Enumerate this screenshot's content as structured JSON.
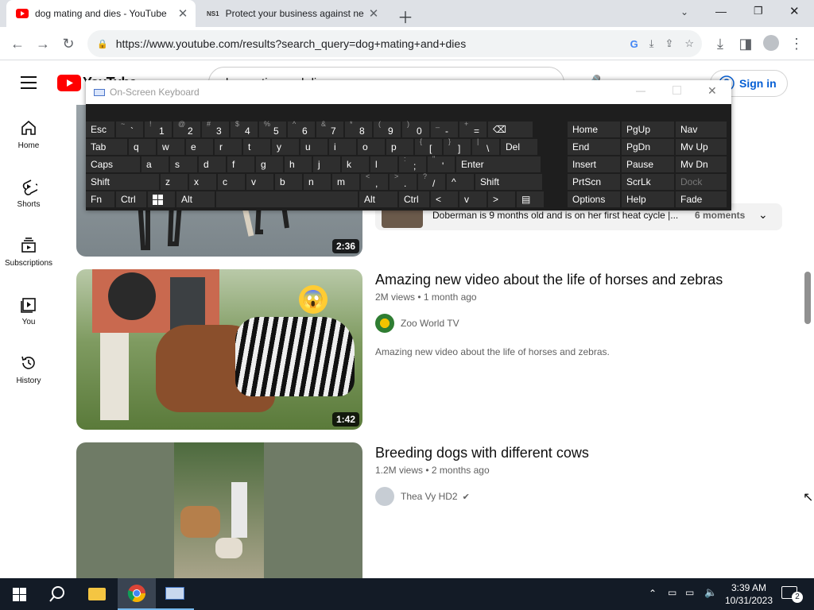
{
  "browser": {
    "tabs": [
      {
        "title": "dog mating and dies - YouTube",
        "active": true
      },
      {
        "title": "Protect your business against ne",
        "active": false
      }
    ],
    "favicon2": "NS1",
    "url": "https://www.youtube.com/results?search_query=dog+mating+and+dies"
  },
  "youtube": {
    "logo_text": "YouTube",
    "sign_in": "Sign in",
    "search_value": "dog mating and dies",
    "sidebar": [
      {
        "label": "Home",
        "icon": "home-icon"
      },
      {
        "label": "Shorts",
        "icon": "shorts-icon"
      },
      {
        "label": "Subscriptions",
        "icon": "subscriptions-icon"
      },
      {
        "label": "You",
        "icon": "you-icon"
      },
      {
        "label": "History",
        "icon": "history-icon"
      }
    ],
    "moments_row": {
      "text": "Doberman is 9 months old and is on her first heat cycle |...",
      "count": "6 moments"
    },
    "videos": [
      {
        "duration": "2:36"
      },
      {
        "title": "Amazing new video about the life of horses and zebras",
        "views": "2M views",
        "age": "1 month ago",
        "channel": "Zoo World TV",
        "description": "Amazing new video about the life of horses and zebras.",
        "duration": "1:42"
      },
      {
        "title": "Breeding dogs with different cows",
        "views": "1.2M views",
        "age": "2 months ago",
        "channel": "Thea Vy HD2",
        "verified": true
      }
    ]
  },
  "osk": {
    "title": "On-Screen Keyboard",
    "rows": [
      [
        {
          "k": "Esc"
        },
        {
          "s": "~",
          "m": "`"
        },
        {
          "s": "!",
          "m": "1"
        },
        {
          "s": "@",
          "m": "2"
        },
        {
          "s": "#",
          "m": "3"
        },
        {
          "s": "$",
          "m": "4"
        },
        {
          "s": "%",
          "m": "5"
        },
        {
          "s": "^",
          "m": "6"
        },
        {
          "s": "&",
          "m": "7"
        },
        {
          "s": "*",
          "m": "8"
        },
        {
          "s": "(",
          "m": "9"
        },
        {
          "s": ")",
          "m": "0"
        },
        {
          "s": "_",
          "m": "-"
        },
        {
          "s": "+",
          "m": "="
        },
        {
          "k": "⌫"
        }
      ],
      [
        {
          "k": "Tab"
        },
        {
          "k": "q"
        },
        {
          "k": "w"
        },
        {
          "k": "e"
        },
        {
          "k": "r"
        },
        {
          "k": "t"
        },
        {
          "k": "y"
        },
        {
          "k": "u"
        },
        {
          "k": "i"
        },
        {
          "k": "o"
        },
        {
          "k": "p"
        },
        {
          "s": "{",
          "m": "["
        },
        {
          "s": "}",
          "m": "]"
        },
        {
          "s": "|",
          "m": "\\"
        },
        {
          "k": "Del"
        }
      ],
      [
        {
          "k": "Caps"
        },
        {
          "k": "a"
        },
        {
          "k": "s"
        },
        {
          "k": "d"
        },
        {
          "k": "f"
        },
        {
          "k": "g"
        },
        {
          "k": "h"
        },
        {
          "k": "j"
        },
        {
          "k": "k"
        },
        {
          "k": "l"
        },
        {
          "s": ":",
          "m": ";"
        },
        {
          "s": "\"",
          "m": "'"
        },
        {
          "k": "Enter"
        }
      ],
      [
        {
          "k": "Shift"
        },
        {
          "k": "z"
        },
        {
          "k": "x"
        },
        {
          "k": "c"
        },
        {
          "k": "v"
        },
        {
          "k": "b"
        },
        {
          "k": "n"
        },
        {
          "k": "m"
        },
        {
          "s": "<",
          "m": ","
        },
        {
          "s": ">",
          "m": "."
        },
        {
          "s": "?",
          "m": "/"
        },
        {
          "k": "^"
        },
        {
          "k": "Shift"
        }
      ],
      [
        {
          "k": "Fn"
        },
        {
          "k": "Ctrl"
        },
        {
          "k": "win"
        },
        {
          "k": "Alt"
        },
        {
          "k": ""
        },
        {
          "k": "Alt"
        },
        {
          "k": "Ctrl"
        },
        {
          "k": "<"
        },
        {
          "k": "v"
        },
        {
          "k": ">"
        },
        {
          "k": "menu"
        }
      ]
    ],
    "right": [
      [
        "Home",
        "PgUp",
        "Nav"
      ],
      [
        "End",
        "PgDn",
        "Mv Up"
      ],
      [
        "Insert",
        "Pause",
        "Mv Dn"
      ],
      [
        "PrtScn",
        "ScrLk",
        "Dock"
      ],
      [
        "Options",
        "Help",
        "Fade"
      ]
    ]
  },
  "taskbar": {
    "time": "3:39 AM",
    "date": "10/31/2023",
    "notifications": "2"
  }
}
